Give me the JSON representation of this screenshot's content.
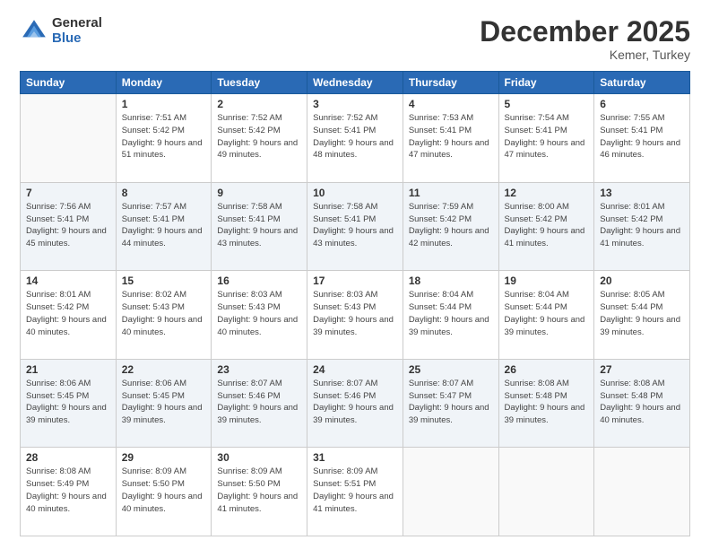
{
  "logo": {
    "general": "General",
    "blue": "Blue"
  },
  "title": "December 2025",
  "subtitle": "Kemer, Turkey",
  "days_of_week": [
    "Sunday",
    "Monday",
    "Tuesday",
    "Wednesday",
    "Thursday",
    "Friday",
    "Saturday"
  ],
  "weeks": [
    [
      {
        "day": "",
        "info": ""
      },
      {
        "day": "1",
        "info": "Sunrise: 7:51 AM\nSunset: 5:42 PM\nDaylight: 9 hours\nand 51 minutes."
      },
      {
        "day": "2",
        "info": "Sunrise: 7:52 AM\nSunset: 5:42 PM\nDaylight: 9 hours\nand 49 minutes."
      },
      {
        "day": "3",
        "info": "Sunrise: 7:52 AM\nSunset: 5:41 PM\nDaylight: 9 hours\nand 48 minutes."
      },
      {
        "day": "4",
        "info": "Sunrise: 7:53 AM\nSunset: 5:41 PM\nDaylight: 9 hours\nand 47 minutes."
      },
      {
        "day": "5",
        "info": "Sunrise: 7:54 AM\nSunset: 5:41 PM\nDaylight: 9 hours\nand 47 minutes."
      },
      {
        "day": "6",
        "info": "Sunrise: 7:55 AM\nSunset: 5:41 PM\nDaylight: 9 hours\nand 46 minutes."
      }
    ],
    [
      {
        "day": "7",
        "info": "Sunrise: 7:56 AM\nSunset: 5:41 PM\nDaylight: 9 hours\nand 45 minutes."
      },
      {
        "day": "8",
        "info": "Sunrise: 7:57 AM\nSunset: 5:41 PM\nDaylight: 9 hours\nand 44 minutes."
      },
      {
        "day": "9",
        "info": "Sunrise: 7:58 AM\nSunset: 5:41 PM\nDaylight: 9 hours\nand 43 minutes."
      },
      {
        "day": "10",
        "info": "Sunrise: 7:58 AM\nSunset: 5:41 PM\nDaylight: 9 hours\nand 43 minutes."
      },
      {
        "day": "11",
        "info": "Sunrise: 7:59 AM\nSunset: 5:42 PM\nDaylight: 9 hours\nand 42 minutes."
      },
      {
        "day": "12",
        "info": "Sunrise: 8:00 AM\nSunset: 5:42 PM\nDaylight: 9 hours\nand 41 minutes."
      },
      {
        "day": "13",
        "info": "Sunrise: 8:01 AM\nSunset: 5:42 PM\nDaylight: 9 hours\nand 41 minutes."
      }
    ],
    [
      {
        "day": "14",
        "info": "Sunrise: 8:01 AM\nSunset: 5:42 PM\nDaylight: 9 hours\nand 40 minutes."
      },
      {
        "day": "15",
        "info": "Sunrise: 8:02 AM\nSunset: 5:43 PM\nDaylight: 9 hours\nand 40 minutes."
      },
      {
        "day": "16",
        "info": "Sunrise: 8:03 AM\nSunset: 5:43 PM\nDaylight: 9 hours\nand 40 minutes."
      },
      {
        "day": "17",
        "info": "Sunrise: 8:03 AM\nSunset: 5:43 PM\nDaylight: 9 hours\nand 39 minutes."
      },
      {
        "day": "18",
        "info": "Sunrise: 8:04 AM\nSunset: 5:44 PM\nDaylight: 9 hours\nand 39 minutes."
      },
      {
        "day": "19",
        "info": "Sunrise: 8:04 AM\nSunset: 5:44 PM\nDaylight: 9 hours\nand 39 minutes."
      },
      {
        "day": "20",
        "info": "Sunrise: 8:05 AM\nSunset: 5:44 PM\nDaylight: 9 hours\nand 39 minutes."
      }
    ],
    [
      {
        "day": "21",
        "info": "Sunrise: 8:06 AM\nSunset: 5:45 PM\nDaylight: 9 hours\nand 39 minutes."
      },
      {
        "day": "22",
        "info": "Sunrise: 8:06 AM\nSunset: 5:45 PM\nDaylight: 9 hours\nand 39 minutes."
      },
      {
        "day": "23",
        "info": "Sunrise: 8:07 AM\nSunset: 5:46 PM\nDaylight: 9 hours\nand 39 minutes."
      },
      {
        "day": "24",
        "info": "Sunrise: 8:07 AM\nSunset: 5:46 PM\nDaylight: 9 hours\nand 39 minutes."
      },
      {
        "day": "25",
        "info": "Sunrise: 8:07 AM\nSunset: 5:47 PM\nDaylight: 9 hours\nand 39 minutes."
      },
      {
        "day": "26",
        "info": "Sunrise: 8:08 AM\nSunset: 5:48 PM\nDaylight: 9 hours\nand 39 minutes."
      },
      {
        "day": "27",
        "info": "Sunrise: 8:08 AM\nSunset: 5:48 PM\nDaylight: 9 hours\nand 40 minutes."
      }
    ],
    [
      {
        "day": "28",
        "info": "Sunrise: 8:08 AM\nSunset: 5:49 PM\nDaylight: 9 hours\nand 40 minutes."
      },
      {
        "day": "29",
        "info": "Sunrise: 8:09 AM\nSunset: 5:50 PM\nDaylight: 9 hours\nand 40 minutes."
      },
      {
        "day": "30",
        "info": "Sunrise: 8:09 AM\nSunset: 5:50 PM\nDaylight: 9 hours\nand 41 minutes."
      },
      {
        "day": "31",
        "info": "Sunrise: 8:09 AM\nSunset: 5:51 PM\nDaylight: 9 hours\nand 41 minutes."
      },
      {
        "day": "",
        "info": ""
      },
      {
        "day": "",
        "info": ""
      },
      {
        "day": "",
        "info": ""
      }
    ]
  ]
}
